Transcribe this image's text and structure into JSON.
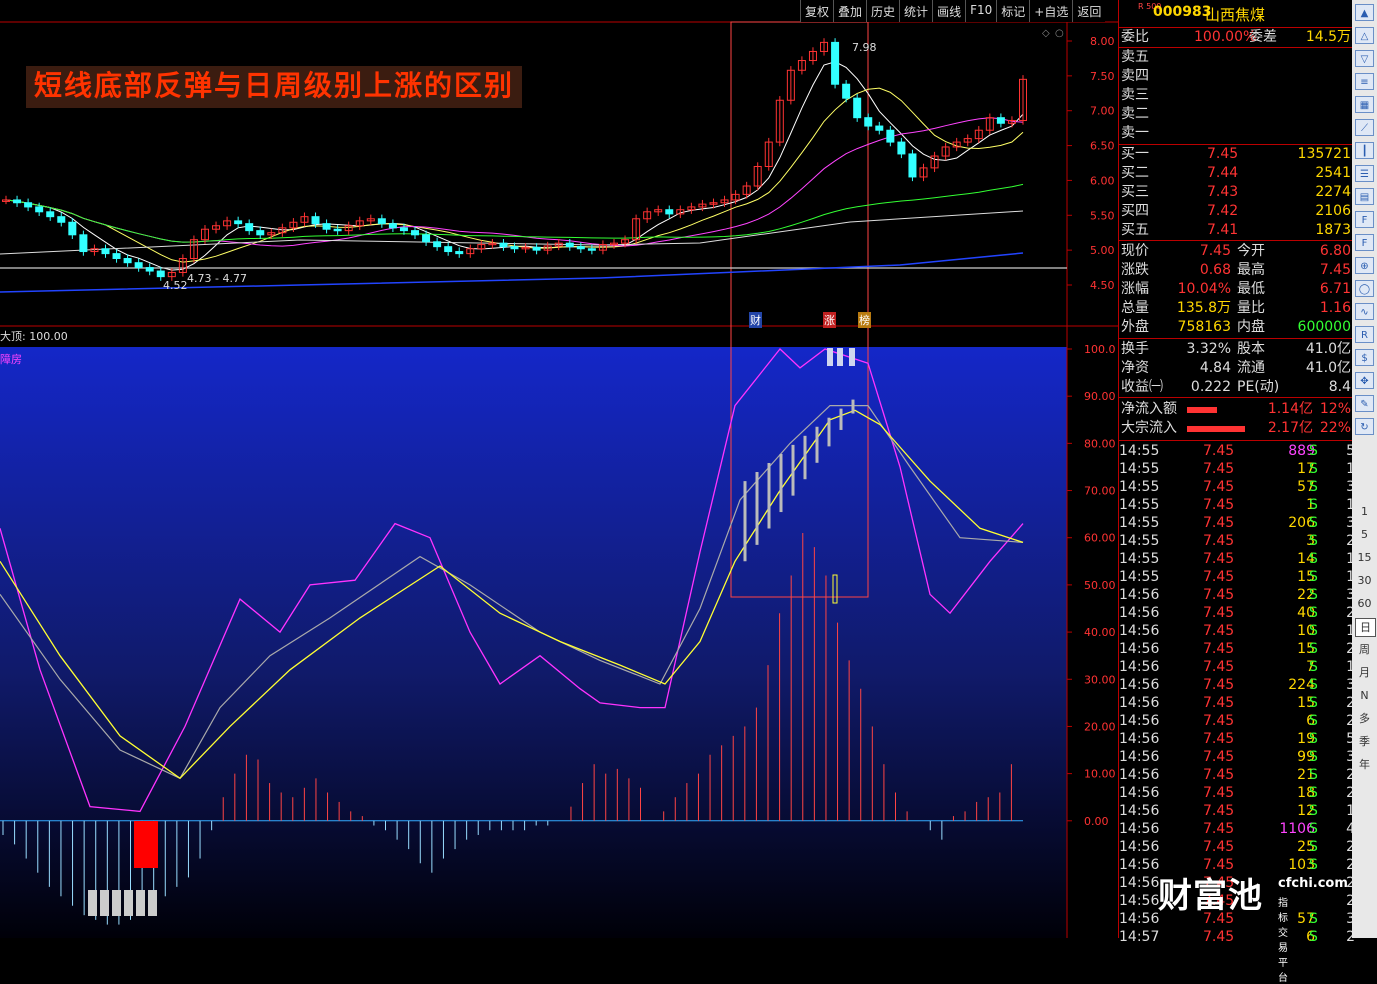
{
  "toolbar": [
    "复权",
    "叠加",
    "历史",
    "统计",
    "画线",
    "F10",
    "标记",
    "+自选",
    "返回"
  ],
  "chart_title": "短线底部反弹与日周级别上涨的区别",
  "price_axis": [
    "8.00",
    "7.50",
    "7.00",
    "6.50",
    "6.00",
    "5.50",
    "5.00",
    "4.50"
  ],
  "indicator_axis": [
    "100.0",
    "90.00",
    "80.00",
    "70.00",
    "60.00",
    "50.00",
    "40.00",
    "30.00",
    "20.00",
    "10.00",
    "0.00"
  ],
  "annotations": {
    "high": "7.98",
    "low": "4.52",
    "range": "4.73 - 4.77"
  },
  "markers": [
    "财",
    "涨",
    "榜"
  ],
  "indicator": {
    "top_label": "大顶: 100.00",
    "name": "障房"
  },
  "colors": {
    "up": "#ff3333",
    "down": "#33ffff",
    "accent": "#ffd700",
    "panel_blue": "#1427c8"
  },
  "quote": {
    "market_tag": "R 500",
    "code": "000983",
    "name": "山西焦煤",
    "weibi_label": "委比",
    "weibi": "100.00%",
    "weicha_label": "委差",
    "weicha": "14.5万",
    "sell": [
      {
        "label": "卖五"
      },
      {
        "label": "卖四"
      },
      {
        "label": "卖三"
      },
      {
        "label": "卖二"
      },
      {
        "label": "卖一"
      }
    ],
    "buy": [
      {
        "label": "买一",
        "price": "7.45",
        "vol": "135721"
      },
      {
        "label": "买二",
        "price": "7.44",
        "vol": "2541"
      },
      {
        "label": "买三",
        "price": "7.43",
        "vol": "2274"
      },
      {
        "label": "买四",
        "price": "7.42",
        "vol": "2106"
      },
      {
        "label": "买五",
        "price": "7.41",
        "vol": "1873"
      }
    ],
    "stats": [
      {
        "l1": "现价",
        "v1": "7.45",
        "l2": "今开",
        "v2": "6.80"
      },
      {
        "l1": "涨跌",
        "v1": "0.68",
        "l2": "最高",
        "v2": "7.45"
      },
      {
        "l1": "涨幅",
        "v1": "10.04%",
        "l2": "最低",
        "v2": "6.71"
      },
      {
        "l1": "总量",
        "v1": "135.8万",
        "l2": "量比",
        "v2": "1.16"
      },
      {
        "l1": "外盘",
        "v1": "758163",
        "l2": "内盘",
        "v2": "600000"
      }
    ],
    "fundamentals": [
      {
        "l1": "换手",
        "v1": "3.32%",
        "l2": "股本",
        "v2": "41.0亿"
      },
      {
        "l1": "净资",
        "v1": "4.84",
        "l2": "流通",
        "v2": "41.0亿"
      },
      {
        "l1": "收益㈠",
        "v1": "0.222",
        "l2": "PE(动)",
        "v2": "8.4"
      }
    ],
    "flows": [
      {
        "label": "净流入额",
        "value": "1.14亿",
        "pct": "12%"
      },
      {
        "label": "大宗流入",
        "value": "2.17亿",
        "pct": "22%"
      }
    ],
    "ticks": [
      {
        "t": "14:55",
        "p": "7.45",
        "v": "889",
        "s": "S",
        "n": "5"
      },
      {
        "t": "14:55",
        "p": "7.45",
        "v": "17",
        "s": "S",
        "n": "1"
      },
      {
        "t": "14:55",
        "p": "7.45",
        "v": "57",
        "s": "S",
        "n": "3"
      },
      {
        "t": "14:55",
        "p": "7.45",
        "v": "1",
        "s": "S",
        "n": "1"
      },
      {
        "t": "14:55",
        "p": "7.45",
        "v": "206",
        "s": "S",
        "n": "3"
      },
      {
        "t": "14:55",
        "p": "7.45",
        "v": "3",
        "s": "S",
        "n": "2"
      },
      {
        "t": "14:55",
        "p": "7.45",
        "v": "14",
        "s": "S",
        "n": "1"
      },
      {
        "t": "14:55",
        "p": "7.45",
        "v": "15",
        "s": "S",
        "n": "1"
      },
      {
        "t": "14:56",
        "p": "7.45",
        "v": "22",
        "s": "S",
        "n": "3"
      },
      {
        "t": "14:56",
        "p": "7.45",
        "v": "40",
        "s": "S",
        "n": "2"
      },
      {
        "t": "14:56",
        "p": "7.45",
        "v": "10",
        "s": "S",
        "n": "1"
      },
      {
        "t": "14:56",
        "p": "7.45",
        "v": "15",
        "s": "S",
        "n": "2"
      },
      {
        "t": "14:56",
        "p": "7.45",
        "v": "7",
        "s": "S",
        "n": "1"
      },
      {
        "t": "14:56",
        "p": "7.45",
        "v": "224",
        "s": "S",
        "n": "3"
      },
      {
        "t": "14:56",
        "p": "7.45",
        "v": "15",
        "s": "S",
        "n": "2"
      },
      {
        "t": "14:56",
        "p": "7.45",
        "v": "6",
        "s": "S",
        "n": "2"
      },
      {
        "t": "14:56",
        "p": "7.45",
        "v": "19",
        "s": "S",
        "n": "5"
      },
      {
        "t": "14:56",
        "p": "7.45",
        "v": "99",
        "s": "S",
        "n": "3"
      },
      {
        "t": "14:56",
        "p": "7.45",
        "v": "21",
        "s": "S",
        "n": "2"
      },
      {
        "t": "14:56",
        "p": "7.45",
        "v": "18",
        "s": "S",
        "n": "2"
      },
      {
        "t": "14:56",
        "p": "7.45",
        "v": "12",
        "s": "S",
        "n": "1"
      },
      {
        "t": "14:56",
        "p": "7.45",
        "v": "1106",
        "s": "S",
        "n": "4"
      },
      {
        "t": "14:56",
        "p": "7.45",
        "v": "25",
        "s": "S",
        "n": "2"
      },
      {
        "t": "14:56",
        "p": "7.45",
        "v": "103",
        "s": "S",
        "n": "2"
      },
      {
        "t": "14:56",
        "p": "7.45",
        "v": "",
        "s": "",
        "n": "2"
      },
      {
        "t": "14:56",
        "p": "7.45",
        "v": "",
        "s": "",
        "n": "2"
      },
      {
        "t": "14:56",
        "p": "7.45",
        "v": "57",
        "s": "S",
        "n": "3"
      },
      {
        "t": "14:57",
        "p": "7.45",
        "v": "6",
        "s": "S",
        "n": "2"
      }
    ]
  },
  "side_toolbar": {
    "icons": [
      "arrow-up-icon",
      "arrow-up-outline-icon",
      "arrow-down-outline-icon",
      "book-icon",
      "grid-icon",
      "line-chart-icon",
      "candle-icon",
      "list-icon",
      "book-icon",
      "f10-icon",
      "f10-icon",
      "zoom-icon",
      "circle-icon",
      "wave-icon",
      "rsi-icon",
      "dollar-icon",
      "move-icon",
      "pen-icon",
      "refresh-icon"
    ],
    "icon_glyphs": [
      "▲",
      "△",
      "▽",
      "≡",
      "▦",
      "⟋",
      "┃",
      "☰",
      "▤",
      "F",
      "F",
      "⊕",
      "◯",
      "∿",
      "R",
      "$",
      "✥",
      "✎",
      "↻"
    ],
    "periods": [
      "1",
      "5",
      "15",
      "30",
      "60",
      "日",
      "周",
      "月",
      "N",
      "多",
      "季",
      "年"
    ]
  },
  "watermark": {
    "cn": "财富池",
    "url": "cfchi.com",
    "sub": "指标交易平台"
  }
}
